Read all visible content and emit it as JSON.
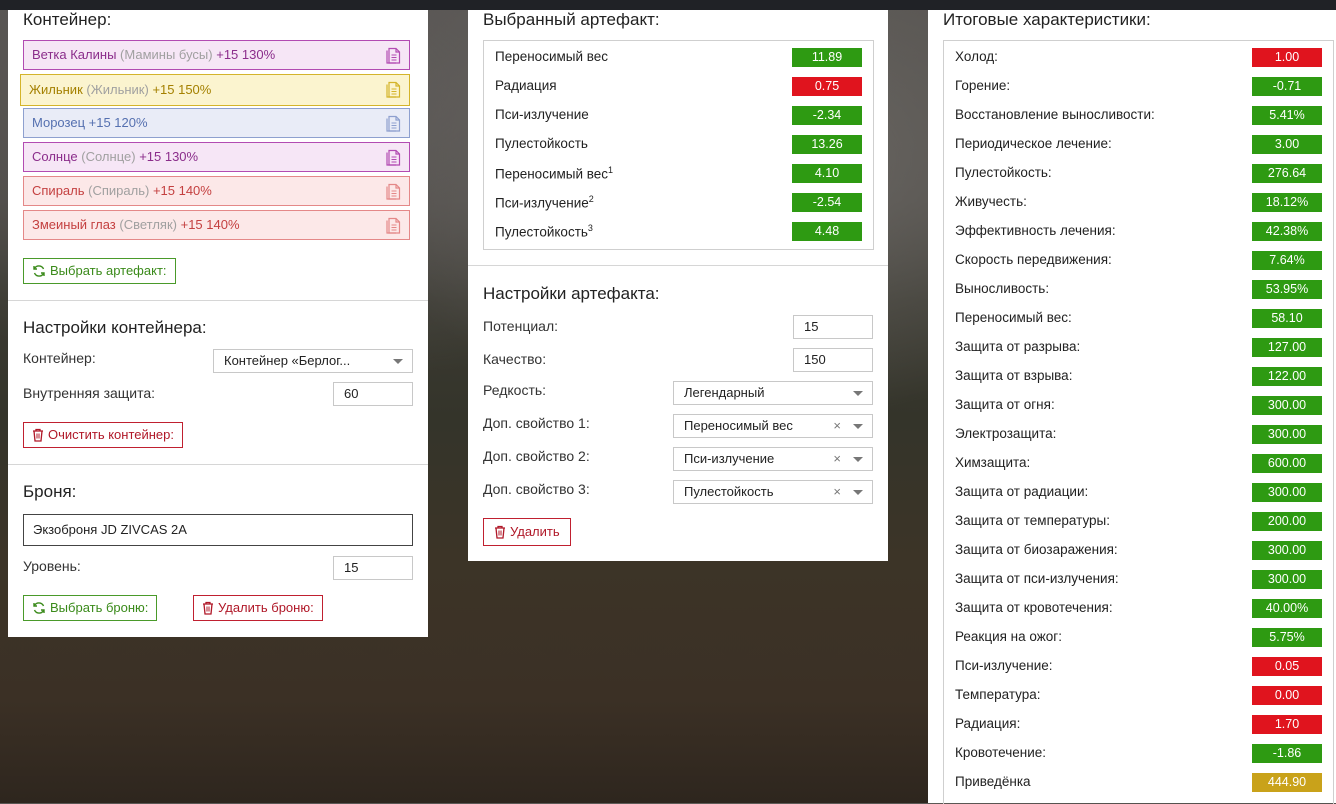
{
  "container": {
    "title": "Контейнер:",
    "artifacts": [
      {
        "name": "Ветка Калины",
        "sub": "(Мамины бусы)",
        "bonus": "+15 130%",
        "color": "purple"
      },
      {
        "name": "Жильник",
        "sub": "(Жильник)",
        "bonus": "+15 150%",
        "color": "yellow"
      },
      {
        "name": "Морозец",
        "sub": "",
        "bonus": "+15 120%",
        "color": "blue"
      },
      {
        "name": "Солнце",
        "sub": "(Солнце)",
        "bonus": "+15 130%",
        "color": "purple"
      },
      {
        "name": "Спираль",
        "sub": "(Спираль)",
        "bonus": "+15 140%",
        "color": "red"
      },
      {
        "name": "Змеиный глаз",
        "sub": "(Светляк)",
        "bonus": "+15 140%",
        "color": "red"
      }
    ],
    "select_artifact_label": "Выбрать артефакт:"
  },
  "container_settings": {
    "title": "Настройки контейнера:",
    "container_label": "Контейнер:",
    "container_value": "Контейнер «Берлог...",
    "inner_protection_label": "Внутренняя защита:",
    "inner_protection_value": "60",
    "clear_label": "Очистить контейнер:"
  },
  "armor": {
    "title": "Броня:",
    "name": "Экзоброня JD ZIVCAS 2A",
    "level_label": "Уровень:",
    "level_value": "15",
    "select_label": "Выбрать броню:",
    "delete_label": "Удалить броню:"
  },
  "selected_artifact": {
    "title": "Выбранный артефакт:",
    "stats": [
      {
        "name": "Переносимый вес",
        "sup": "",
        "value": "11.89",
        "color": "green"
      },
      {
        "name": "Радиация",
        "sup": "",
        "value": "0.75",
        "color": "red"
      },
      {
        "name": "Пси-излучение",
        "sup": "",
        "value": "-2.34",
        "color": "green"
      },
      {
        "name": "Пулестойкость",
        "sup": "",
        "value": "13.26",
        "color": "green"
      },
      {
        "name": "Переносимый вес",
        "sup": "1",
        "value": "4.10",
        "color": "green"
      },
      {
        "name": "Пси-излучение",
        "sup": "2",
        "value": "-2.54",
        "color": "green"
      },
      {
        "name": "Пулестойкость",
        "sup": "3",
        "value": "4.48",
        "color": "green"
      }
    ]
  },
  "artifact_settings": {
    "title": "Настройки артефакта:",
    "potential_label": "Потенциал:",
    "potential_value": "15",
    "quality_label": "Качество:",
    "quality_value": "150",
    "rarity_label": "Редкость:",
    "rarity_value": "Легендарный",
    "extra1_label": "Доп. свойство 1:",
    "extra1_value": "Переносимый вес",
    "extra2_label": "Доп. свойство 2:",
    "extra2_value": "Пси-излучение",
    "extra3_label": "Доп. свойство 3:",
    "extra3_value": "Пулестойкость",
    "clear_symbol": "×",
    "delete_label": "Удалить"
  },
  "totals": {
    "title": "Итоговые характеристики:",
    "stats": [
      {
        "name": "Холод:",
        "value": "1.00",
        "color": "red"
      },
      {
        "name": "Горение:",
        "value": "-0.71",
        "color": "green"
      },
      {
        "name": "Восстановление выносливости:",
        "value": "5.41%",
        "color": "green"
      },
      {
        "name": "Периодическое лечение:",
        "value": "3.00",
        "color": "green"
      },
      {
        "name": "Пулестойкость:",
        "value": "276.64",
        "color": "green"
      },
      {
        "name": "Живучесть:",
        "value": "18.12%",
        "color": "green"
      },
      {
        "name": "Эффективность лечения:",
        "value": "42.38%",
        "color": "green"
      },
      {
        "name": "Скорость передвижения:",
        "value": "7.64%",
        "color": "green"
      },
      {
        "name": "Выносливость:",
        "value": "53.95%",
        "color": "green"
      },
      {
        "name": "Переносимый вес:",
        "value": "58.10",
        "color": "green"
      },
      {
        "name": "Защита от разрыва:",
        "value": "127.00",
        "color": "green"
      },
      {
        "name": "Защита от взрыва:",
        "value": "122.00",
        "color": "green"
      },
      {
        "name": "Защита от огня:",
        "value": "300.00",
        "color": "green"
      },
      {
        "name": "Электрозащита:",
        "value": "300.00",
        "color": "green"
      },
      {
        "name": "Химзащита:",
        "value": "600.00",
        "color": "green"
      },
      {
        "name": "Защита от радиации:",
        "value": "300.00",
        "color": "green"
      },
      {
        "name": "Защита от температуры:",
        "value": "200.00",
        "color": "green"
      },
      {
        "name": "Защита от биозаражения:",
        "value": "300.00",
        "color": "green"
      },
      {
        "name": "Защита от пси-излучения:",
        "value": "300.00",
        "color": "green"
      },
      {
        "name": "Защита от кровотечения:",
        "value": "40.00%",
        "color": "green"
      },
      {
        "name": "Реакция на ожог:",
        "value": "5.75%",
        "color": "green"
      },
      {
        "name": "Пси-излучение:",
        "value": "0.05",
        "color": "red"
      },
      {
        "name": "Температура:",
        "value": "0.00",
        "color": "red"
      },
      {
        "name": "Радиация:",
        "value": "1.70",
        "color": "red"
      },
      {
        "name": "Кровотечение:",
        "value": "-1.86",
        "color": "green"
      },
      {
        "name": "Приведёнка",
        "value": "444.90",
        "color": "yellow"
      }
    ]
  },
  "icons": [
    "copy-icon",
    "refresh-icon",
    "trash-icon",
    "chevron-down-icon",
    "clear-icon"
  ],
  "colors": {
    "green": "#2e9a12",
    "red": "#e0141e",
    "yellow": "#c9a21a"
  }
}
